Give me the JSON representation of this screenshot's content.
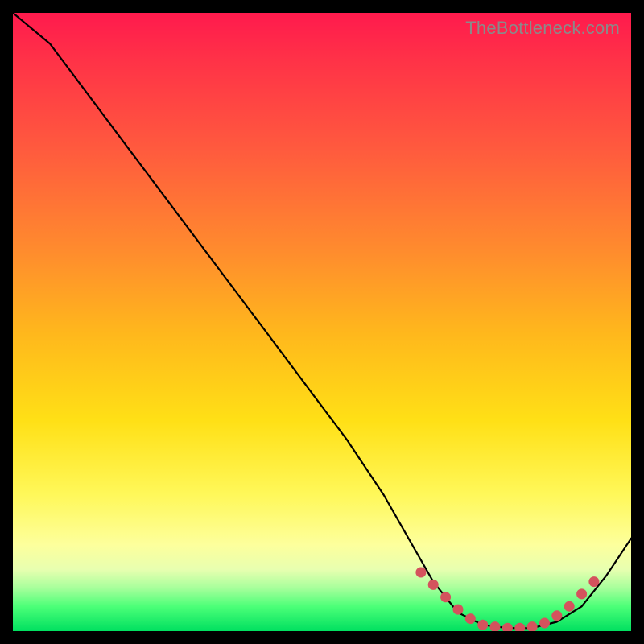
{
  "watermark": "TheBottleneck.com",
  "colors": {
    "frame": "#000000",
    "marker": "#d4535d",
    "curve": "#000000"
  },
  "chart_data": {
    "type": "line",
    "title": "",
    "xlabel": "",
    "ylabel": "",
    "xlim": [
      0,
      100
    ],
    "ylim": [
      0,
      100
    ],
    "grid": false,
    "legend": false,
    "series": [
      {
        "name": "bottleneck-curve",
        "x": [
          0,
          6,
          12,
          18,
          24,
          30,
          36,
          42,
          48,
          54,
          60,
          64,
          68,
          72,
          76,
          80,
          84,
          88,
          92,
          96,
          100
        ],
        "y": [
          100,
          95,
          87,
          79,
          71,
          63,
          55,
          47,
          39,
          31,
          22,
          15,
          8,
          3,
          1,
          0.5,
          0.5,
          1.5,
          4,
          9,
          15
        ]
      }
    ],
    "markers": {
      "name": "highlighted-points",
      "x": [
        66,
        68,
        70,
        72,
        74,
        76,
        78,
        80,
        82,
        84,
        86,
        88,
        90,
        92,
        94
      ],
      "y": [
        9.5,
        7.5,
        5.5,
        3.5,
        2,
        1,
        0.7,
        0.5,
        0.5,
        0.7,
        1.3,
        2.5,
        4,
        6,
        8
      ]
    }
  }
}
